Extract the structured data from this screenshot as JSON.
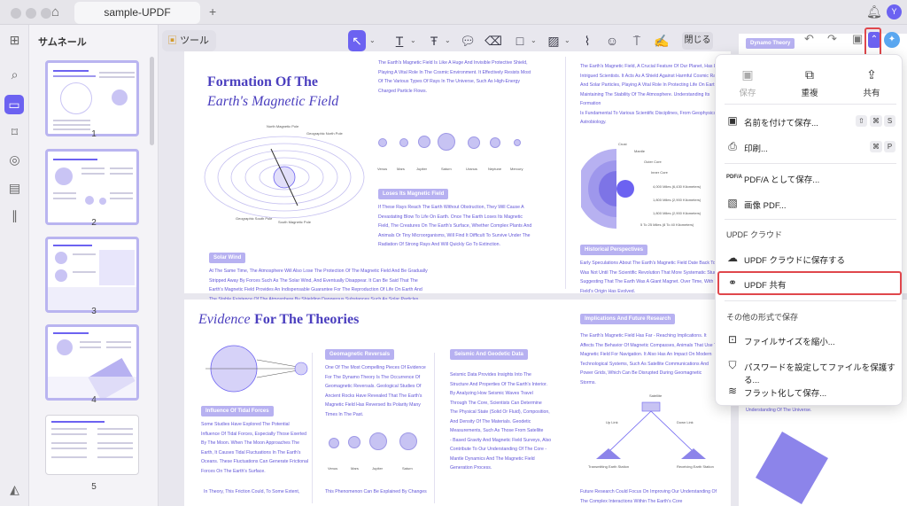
{
  "window": {
    "tab_title": "sample-UPDF",
    "new_tab": "+"
  },
  "avatar": {
    "initial": "Y"
  },
  "sidebar": {
    "title": "サムネール",
    "pages": [
      "1",
      "2",
      "3",
      "4",
      "5"
    ]
  },
  "toolbar": {
    "tools_label": "ツール",
    "close_label": "閉じる"
  },
  "page1": {
    "title_line1": "Formation Of The",
    "title_line2": "Earth's Magnetic Field",
    "solar_wind": "Solar Wind",
    "loses": "Loses Its Magnetic Field",
    "historical": "Historical Perspectives",
    "para_top": [
      "The Earth's Magnetic Field Is Like A Huge And Invisible Protective Shield,",
      "Playing A Vital Role In The Cosmic Environment. It Effectively Resists Most",
      "Of The Various Types Of Rays In The Universe, Such As High-Energy",
      "Charged Particle Flows."
    ],
    "para_mid": [
      "If These Rays Reach The Earth Without Obstruction, They Will Cause A",
      "Devastating Blow To Life On Earth. Once The Earth Loses Its Magnetic",
      "Field, The Creatures On The Earth's Surface, Whether Complex Plants And",
      "Animals Or Tiny Microorganisms, Will Find It Difficult To Survive Under The",
      "Radiation Of Strong Rays And Will Quickly Go To Extinction."
    ],
    "para_bottom": [
      "At The Same Time, The Atmosphere Will Also Lose The Protection Of The Magnetic Field And Be Gradually",
      "Stripped Away By Forces Such As The Solar Wind, And Eventually Disappear. It Can Be Said That The",
      "Earth's Magnetic Field Provides An Indispensable Guarantee For The Reproduction Of Life On Earth And",
      "The Stable Existence Of The Atmosphere By Shielding Dangerous Substances Such As Solar Particles"
    ],
    "para_right": [
      "The Earth's Magnetic Field, A Crucial Feature Of Our Planet, Has Long",
      "Intrigued Scientists. It Acts As A Shield Against Harmful Cosmic Radiation",
      "And Solar Particles, Playing A Vital Role In Protecting Life On Earth,",
      "Maintaining The Stability Of The Atmosphere. Understanding Its Formation",
      "Is Fundamental To Various Scientific Disciplines, From Geophysics To",
      "Astrobiology."
    ],
    "para_hist": [
      "Early Speculations About The Earth's Magnetic Field Date Back To Ancient Times",
      "Was Not Until The Scientific Revolution That More Systematic Studies Be",
      "Suggesting That The Earth Was A Giant Magnet. Over Time, With The D",
      "Field's Origin Has Evolved."
    ],
    "planets": [
      "Venus",
      "Mars",
      "Jupiter",
      "Saturn",
      "Uranus",
      "Neptune",
      "Mercury"
    ],
    "layers": [
      "Crust",
      "Mantle",
      "Outer Core",
      "Inner Core",
      "4,000 Miles (6,430 Kilometers)",
      "1,800 Miles (2,900 Kilometers)",
      "1,800 Miles (2,900 Kilometers)",
      "5 To 25 Miles (8 To 40 Kilometers)"
    ],
    "field_labels": [
      "North Magnetic Pole",
      "Geographic North Pole",
      "Geographic South Pole",
      "South Magnetic Pole"
    ]
  },
  "page2": {
    "title_em": "Evidence",
    "title_rest": "For The Theories",
    "geo": "Geomagnetic Reversals",
    "seismic": "Seismic And Geodetic Data",
    "tidal": "Influence Of Tidal Forces",
    "implications": "Implications And Future Research",
    "col_geo": [
      "One Of The Most Compelling Pieces Of Evidence",
      "For The Dynamo Theory Is The Occurrence Of",
      "Geomagnetic Reversals. Geological Studies Of",
      "Ancient Rocks Have Revealed That The Earth's",
      "Magnetic Field Has Reversed Its Polarity Many",
      "Times In The Past."
    ],
    "col_seis": [
      "Seismic Data Provides Insights Into The",
      "Structure And Properties Of The Earth's Interior.",
      "By Analyzing How Seismic Waves Travel",
      "Through The Core, Scientists Can Determine",
      "The Physical State (Solid Or Fluid), Composition,",
      "And Density Of The Materials. Geodetic",
      "Measurements, Such As Those From Satellite",
      "- Based Gravity And Magnetic Field Surveys, Also",
      "Contribute To Our Understanding Of The Core -",
      "Mantle Dynamics And The Magnetic Field",
      "Generation Process."
    ],
    "col_tidal": [
      "Some Studies Have Explored The Potential",
      "Influence Of Tidal Forces, Especially Those Exerted",
      "By The Moon. When The Moon Approaches The",
      "Earth, It Causes Tidal Fluctuations In The Earth's",
      "Oceans. These Fluctuations Can Generate Frictional",
      "Forces On The Earth's Surface."
    ],
    "col_impl": [
      "The Earth's Magnetic Field Has Far - Reaching Implications. It",
      "Affects The Behavior Of Magnetic Compasses, Animals That Use The",
      "Magnetic Field For Navigation. It Also Has An Impact On Modern",
      "Technological Systems, Such As Satellite Communications And",
      "Power Grids, Which Can Be Disrupted During Geomagnetic",
      "Storms."
    ],
    "tail_tidal": "In Theory, This Friction Could, To Some Extent,",
    "tail_geo": "This Phenomenon Can Be Explained By Changes",
    "future": "Future Research Could Focus On Improving Our Understanding Of",
    "future2": "The Complex Interactions Within The Earth's Core",
    "sat_labels": [
      "Satellite",
      "Up Link",
      "Down Link",
      "Transmitting Earth Station",
      "Receiving Earth Station"
    ],
    "planets": [
      "Venus",
      "Mars",
      "Jupiter",
      "Saturn"
    ]
  },
  "page3": {
    "tag": "Dynamo Theory",
    "text": "Understanding Of The Universe."
  },
  "menu": {
    "quick": [
      {
        "icon": "save-icon",
        "label": "保存",
        "disabled": true
      },
      {
        "icon": "duplicate-icon",
        "label": "重複",
        "disabled": false
      },
      {
        "icon": "share-icon",
        "label": "共有",
        "disabled": false
      }
    ],
    "items": [
      {
        "key": "save_as",
        "label": "名前を付けて保存...",
        "shortcut": [
          "⇧",
          "⌘",
          "S"
        ]
      },
      {
        "key": "print",
        "label": "印刷...",
        "shortcut": [
          "⌘",
          "P"
        ]
      },
      {
        "key": "pdfa",
        "label": "PDF/A として保存...",
        "shortcut": []
      },
      {
        "key": "image_pdf",
        "label": "画像 PDF...",
        "shortcut": []
      },
      {
        "key": "cloud_save",
        "label": "UPDF クラウドに保存する",
        "shortcut": []
      },
      {
        "key": "share",
        "label": "UPDF 共有",
        "shortcut": []
      },
      {
        "key": "reduce",
        "label": "ファイルサイズを縮小...",
        "shortcut": []
      },
      {
        "key": "protect",
        "label": "パスワードを設定してファイルを保護する...",
        "shortcut": []
      },
      {
        "key": "flatten",
        "label": "フラット化して保存...",
        "shortcut": []
      }
    ],
    "section_cloud": "UPDF クラウド",
    "section_other": "その他の形式で保存"
  },
  "colors": {
    "accent": "#6c62f1",
    "highlight": "#e0474c",
    "heading": "#4b3fbf"
  }
}
